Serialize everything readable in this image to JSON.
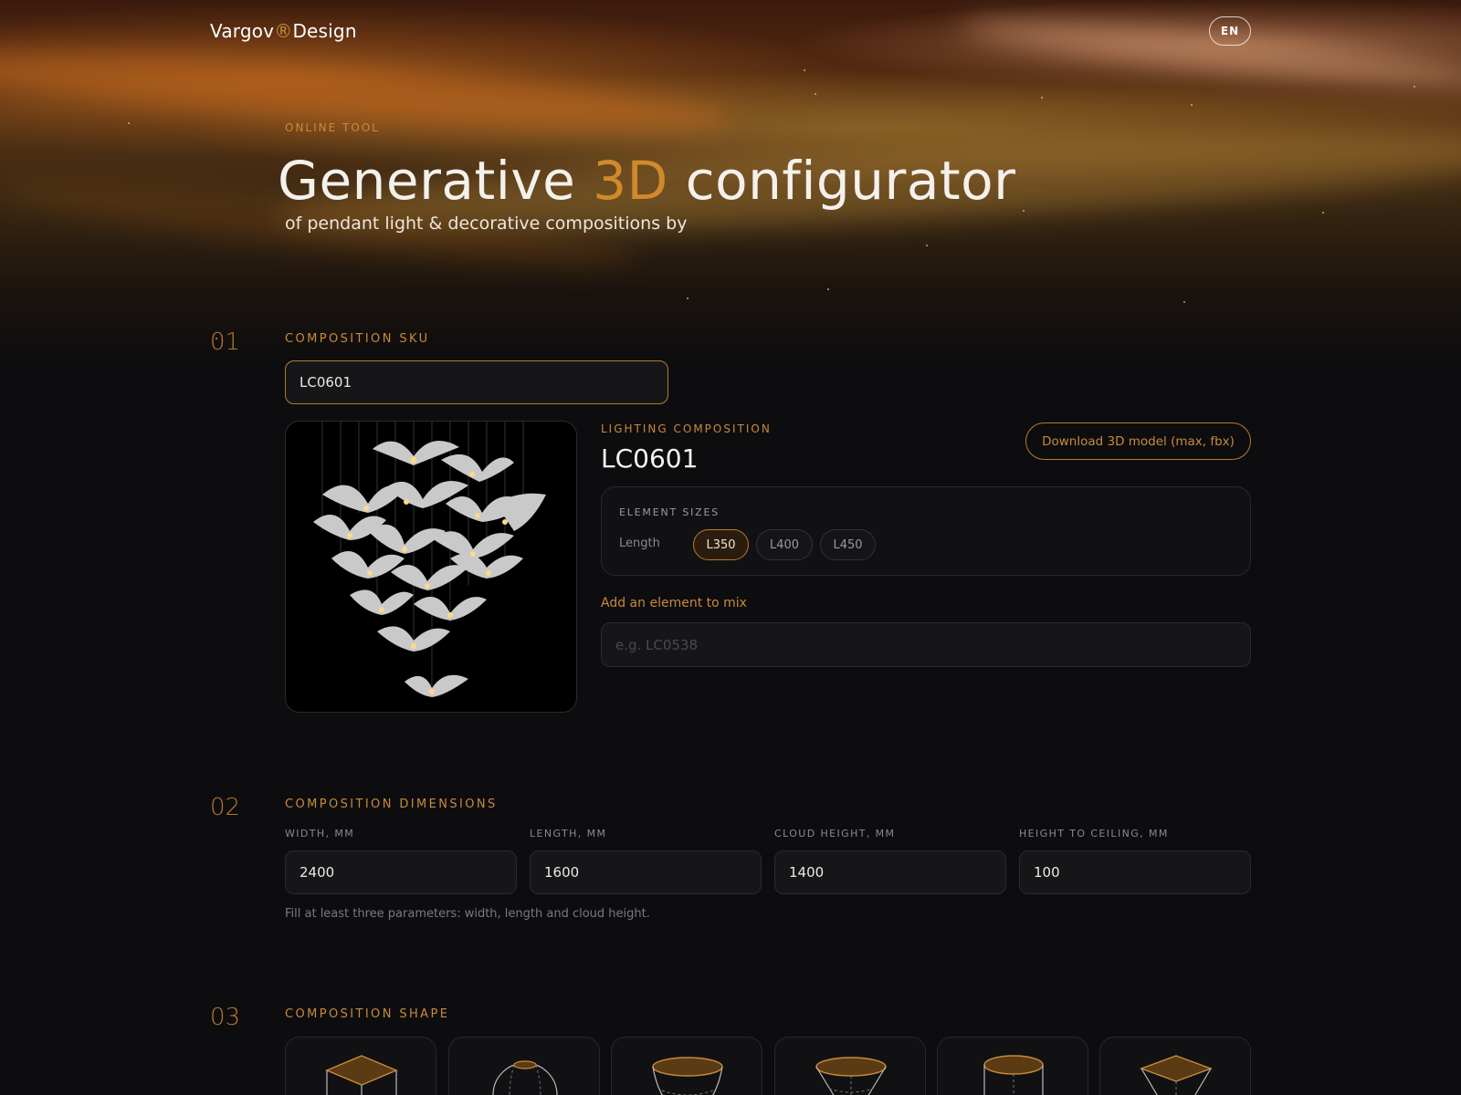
{
  "header": {
    "brand_prefix": "Vargov",
    "brand_mark": "®",
    "brand_suffix": "Design",
    "lang": "EN"
  },
  "hero": {
    "eyebrow": "ONLINE TOOL",
    "title_part1": "Generative ",
    "title_accent": "3D",
    "title_part2": " configurator",
    "subtitle": "of pendant light & decorative compositions by"
  },
  "step1": {
    "number": "01",
    "label": "COMPOSITION SKU",
    "sku_value": "LC0601",
    "composition_label": "LIGHTING COMPOSITION",
    "composition_name": "LC0601",
    "download_label": "Download 3D model (max, fbx)",
    "element_sizes_label": "ELEMENT SIZES",
    "length_label": "Length",
    "sizes": [
      "L350",
      "L400",
      "L450"
    ],
    "selected_size": "L350",
    "mix_label": "Add an element to mix",
    "mix_placeholder": "e.g. LC0538"
  },
  "step2": {
    "number": "02",
    "label": "COMPOSITION DIMENSIONS",
    "fields": [
      {
        "label": "WIDTH, MM",
        "value": "2400"
      },
      {
        "label": "LENGTH, MM",
        "value": "1600"
      },
      {
        "label": "CLOUD HEIGHT, MM",
        "value": "1400"
      },
      {
        "label": "HEIGHT TO CEILING, MM",
        "value": "100"
      }
    ],
    "hint": "Fill at least three parameters: width, length and cloud height."
  },
  "step3": {
    "number": "03",
    "label": "COMPOSITION SHAPE",
    "shapes": [
      "cube-icon",
      "sphere-icon",
      "bowl-icon",
      "cone-icon",
      "cylinder-icon",
      "pyramid-icon"
    ]
  },
  "colors": {
    "accent": "#c98a3a",
    "background": "#0d0d0f",
    "field": "#161618"
  }
}
